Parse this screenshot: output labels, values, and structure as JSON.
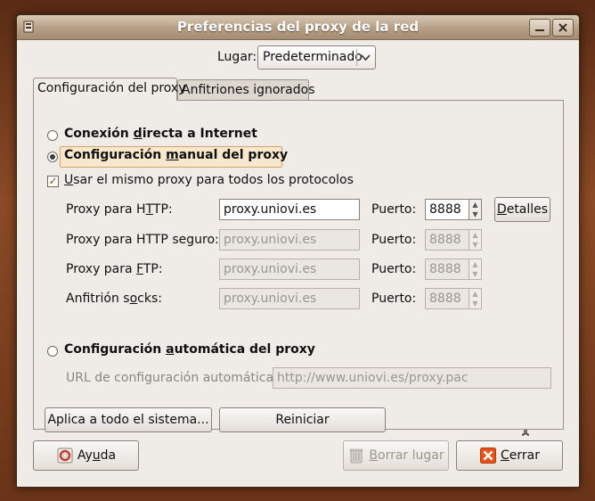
{
  "window": {
    "title": "Preferencias del proxy de la red"
  },
  "location": {
    "label": "Lugar:",
    "selected": "Predeterminado"
  },
  "tabs": [
    {
      "label": "Configuración del proxy",
      "active": true
    },
    {
      "label": "Anfitriones ignorados",
      "active": false
    }
  ],
  "direct": {
    "label_pre": "Conexión ",
    "label_ul": "d",
    "label_post": "irecta a Internet"
  },
  "manual": {
    "label_pre": "Configuración ",
    "label_ul": "m",
    "label_post": "anual del proxy",
    "same_proxy": {
      "label_ul": "U",
      "label_post": "sar el mismo proxy para todos los protocolos",
      "checked": true
    },
    "rows": [
      {
        "label_pre": "Proxy para H",
        "label_ul": "T",
        "label_post": "TP:",
        "value": "proxy.uniovi.es",
        "port_label": "Puerto:",
        "port": "8888",
        "enabled": true
      },
      {
        "label_pre": "Proxy para HTTP seguro:",
        "label_ul": "",
        "label_post": "",
        "value": "proxy.uniovi.es",
        "port_label": "Puerto:",
        "port": "8888",
        "enabled": false
      },
      {
        "label_pre": "Proxy para ",
        "label_ul": "F",
        "label_post": "TP:",
        "value": "proxy.uniovi.es",
        "port_label": "Puerto:",
        "port": "8888",
        "enabled": false
      },
      {
        "label_pre": "Anfitrión s",
        "label_ul": "o",
        "label_post": "cks:",
        "value": "proxy.uniovi.es",
        "port_label": "Puerto:",
        "port": "8888",
        "enabled": false
      }
    ],
    "details_pre": "",
    "details_ul": "D",
    "details_post": "etalles"
  },
  "auto": {
    "label_pre": "Configuración ",
    "label_ul": "a",
    "label_post": "utomática del proxy",
    "url_label": "URL de configuración automática:",
    "url_value": "http://www.uniovi.es/proxy.pac"
  },
  "panel_buttons": {
    "apply": "Aplica a todo el sistema...",
    "reset": "Reiniciar"
  },
  "footer": {
    "help_pre": "Ay",
    "help_ul": "u",
    "help_post": "da",
    "delete_ul": "B",
    "delete_post": "orrar lugar",
    "close_ul": "C",
    "close_post": "errar"
  },
  "colors": {
    "accent": "#e07a20",
    "titlebar": "#b59e84",
    "close_icon": "#e8531a"
  }
}
